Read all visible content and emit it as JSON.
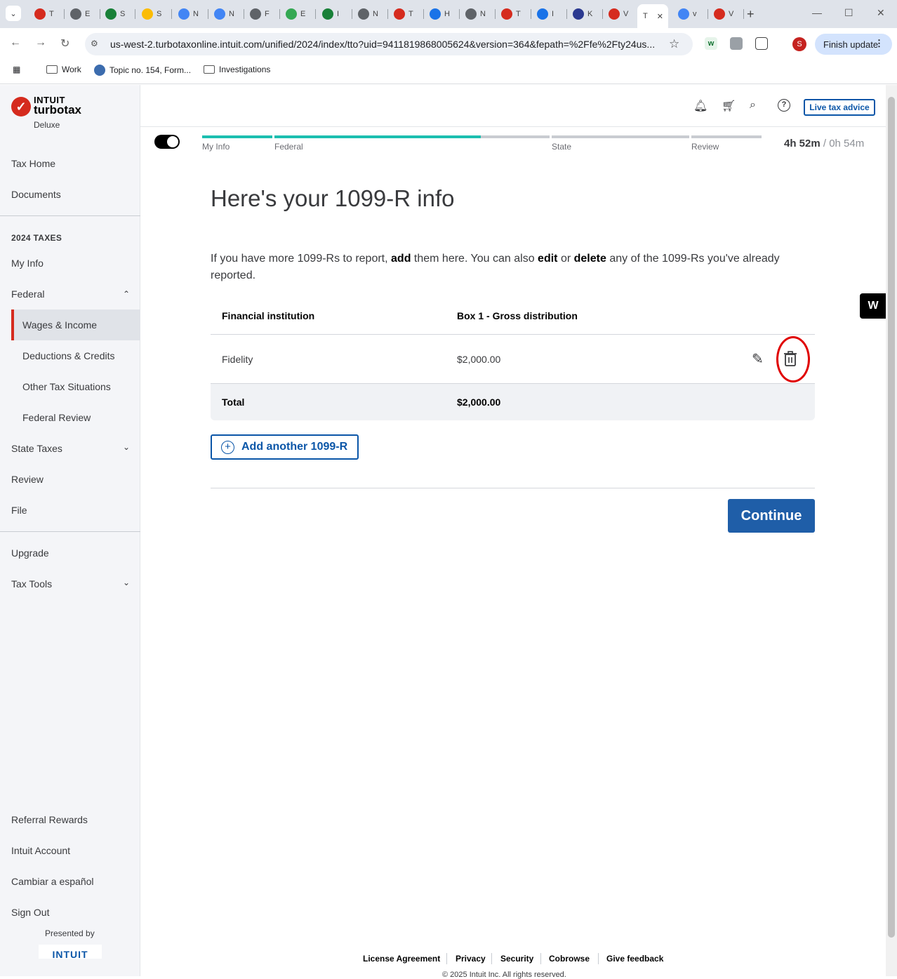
{
  "browser": {
    "tabs": [
      {
        "letter": "T",
        "color": "#d52b1e"
      },
      {
        "letter": "E",
        "color": "#5f6368"
      },
      {
        "letter": "S",
        "color": "#188038"
      },
      {
        "letter": "S",
        "color": "#fbbc04"
      },
      {
        "letter": "N",
        "color": "#4285f4"
      },
      {
        "letter": "N",
        "color": "#4285f4"
      },
      {
        "letter": "F",
        "color": "#5f6368"
      },
      {
        "letter": "E",
        "color": "#34a853"
      },
      {
        "letter": "I",
        "color": "#188038"
      },
      {
        "letter": "N",
        "color": "#5f6368"
      },
      {
        "letter": "T",
        "color": "#d52b1e"
      },
      {
        "letter": "H",
        "color": "#1a73e8"
      },
      {
        "letter": "N",
        "color": "#5f6368"
      },
      {
        "letter": "T",
        "color": "#d52b1e"
      },
      {
        "letter": "I",
        "color": "#1a73e8"
      },
      {
        "letter": "K",
        "color": "#2b3990"
      },
      {
        "letter": "V",
        "color": "#d52b1e"
      }
    ],
    "active_tab": {
      "letter": "T"
    },
    "after_tabs": [
      {
        "letter": "v",
        "color": "#4285f4"
      },
      {
        "letter": "V",
        "color": "#d52b1e"
      }
    ],
    "url": "us-west-2.turbotaxonline.intuit.com/unified/2024/index/tto?uid=9411819868005624&version=364&fepath=%2Ffe%2Fty24us...",
    "finish_update": "Finish update",
    "profile_initial": "S",
    "bookmarks": [
      "Work",
      "Topic no. 154, Form...",
      "Investigations"
    ]
  },
  "brand": {
    "intuit": "INTUIT",
    "product": "turbotax",
    "edition": "Deluxe"
  },
  "sidebar": {
    "tax_home": "Tax Home",
    "documents": "Documents",
    "section": "2024 TAXES",
    "my_info": "My Info",
    "federal": "Federal",
    "wages": "Wages & Income",
    "deductions": "Deductions & Credits",
    "other": "Other Tax Situations",
    "federal_review": "Federal Review",
    "state": "State Taxes",
    "review": "Review",
    "file": "File",
    "upgrade": "Upgrade",
    "tax_tools": "Tax Tools",
    "referral": "Referral Rewards",
    "account": "Intuit Account",
    "spanish": "Cambiar a español",
    "sign_out": "Sign Out",
    "presented_by": "Presented by",
    "presented_logo": "INTUIT"
  },
  "header": {
    "live_advice": "Live tax advice"
  },
  "progress": {
    "steps": [
      "My Info",
      "Federal",
      "State",
      "Review"
    ],
    "federal_fill": 0.5,
    "time_elapsed": "4h 52m",
    "time_remaining": "/ 0h 54m"
  },
  "main": {
    "title": "Here's your 1099-R info",
    "intro": {
      "p1": "If you have more 1099-Rs to report, ",
      "add": "add",
      "p2": " them here. You can also ",
      "edit": "edit",
      "p3": " or ",
      "delete": "delete",
      "p4": " any of the 1099-Rs you've already reported."
    },
    "table": {
      "headers": [
        "Financial institution",
        "Box 1 - Gross distribution"
      ],
      "rows": [
        {
          "institution": "Fidelity",
          "amount": "$2,000.00"
        }
      ],
      "total_label": "Total",
      "total_amount": "$2,000.00"
    },
    "add_button": "Add another 1099-R",
    "continue": "Continue"
  },
  "side_badge": "W",
  "footer": {
    "links": [
      "License Agreement",
      "Privacy",
      "Security",
      "Cobrowse",
      "Give feedback"
    ],
    "copyright": "© 2025 Intuit Inc. All rights reserved."
  }
}
